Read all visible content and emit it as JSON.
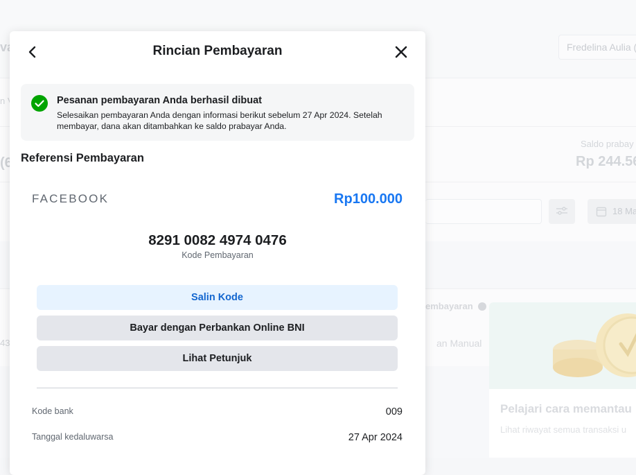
{
  "background": {
    "user_name": "Fredelina Aulia (",
    "saldo_label": "Saldo prabay",
    "saldo_value": "Rp 244.56",
    "date_filter": "18 Ma",
    "column_label": "embayaran",
    "method_text": "an Manual",
    "card_title": "Pelajari cara memantau",
    "card_subtitle": "Lihat riwayat semua transaksi u",
    "edge_texts": [
      "va",
      "n V",
      "(6",
      "43"
    ]
  },
  "modal": {
    "title": "Rincian Pembayaran",
    "alert": {
      "title": "Pesanan pembayaran Anda berhasil dibuat",
      "body": "Selesaikan pembayaran Anda dengan informasi berikut sebelum 27 Apr 2024. Setelah membayar, dana akan ditambahkan ke saldo prabayar Anda.",
      "icon": "check-circle-icon",
      "color": "#00a400"
    },
    "section_title": "Referensi Pembayaran",
    "merchant": "FACEBOOK",
    "amount": "Rp100.000",
    "payment_code": "8291 0082 4974 0476",
    "payment_code_label": "Kode Pembayaran",
    "buttons": {
      "copy": "Salin Kode",
      "bank": "Bayar dengan Perbankan Online BNI",
      "guide": "Lihat Petunjuk"
    },
    "details": [
      {
        "label": "Kode bank",
        "value": "009"
      },
      {
        "label": "Tanggal kedaluwarsa",
        "value": "27 Apr 2024"
      }
    ]
  },
  "colors": {
    "accent": "#1877f2",
    "success": "#00a400",
    "copy_button_bg": "#e7f3ff",
    "secondary_button_bg": "#e4e6eb"
  }
}
